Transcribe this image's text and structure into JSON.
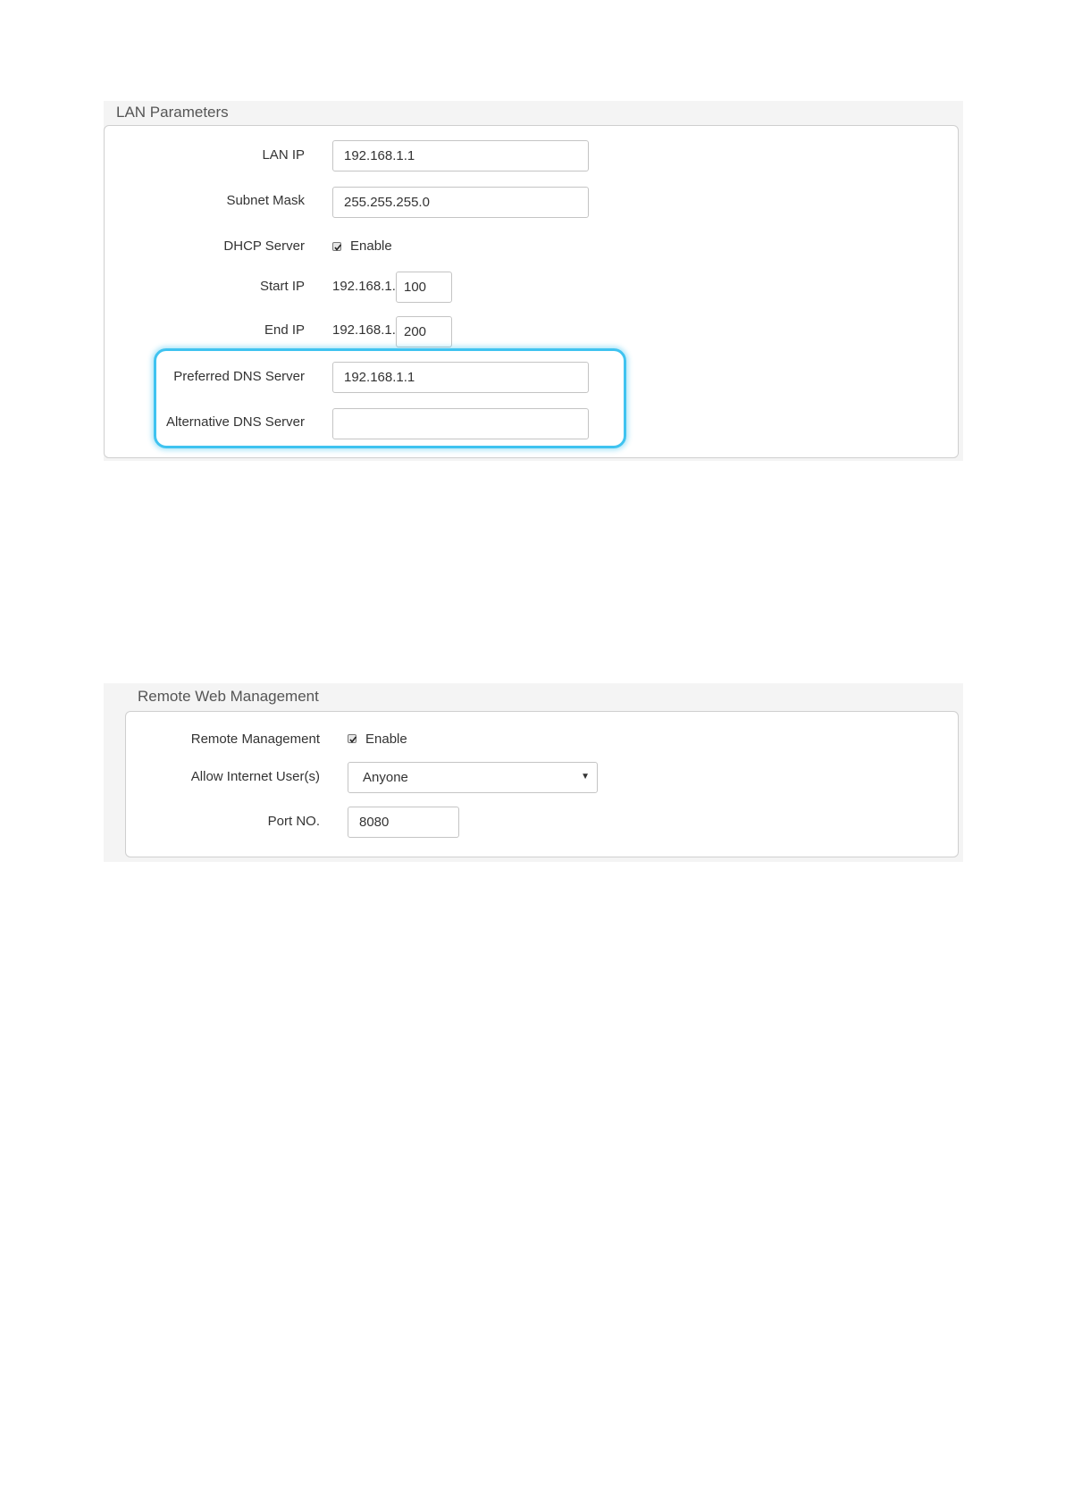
{
  "lan_panel": {
    "title": "LAN Parameters",
    "lan_ip": {
      "label": "LAN IP",
      "value": "192.168.1.1"
    },
    "subnet_mask": {
      "label": "Subnet Mask",
      "value": "255.255.255.0"
    },
    "dhcp_server": {
      "label": "DHCP Server",
      "checkbox_label": "Enable",
      "checked": true
    },
    "start_ip": {
      "label": "Start IP",
      "prefix": "192.168.1.",
      "value": "100"
    },
    "end_ip": {
      "label": "End IP",
      "prefix": "192.168.1.",
      "value": "200"
    },
    "preferred_dns": {
      "label": "Preferred DNS Server",
      "value": "192.168.1.1"
    },
    "alternative_dns": {
      "label": "Alternative DNS Server",
      "value": ""
    },
    "highlight_color": "#3fc3f0"
  },
  "remote_panel": {
    "title": "Remote Web Management",
    "remote_management": {
      "label": "Remote Management",
      "checkbox_label": "Enable",
      "checked": true
    },
    "allow_users": {
      "label": "Allow Internet User(s)",
      "selected": "Anyone"
    },
    "port": {
      "label": "Port NO.",
      "value": "8080"
    }
  }
}
